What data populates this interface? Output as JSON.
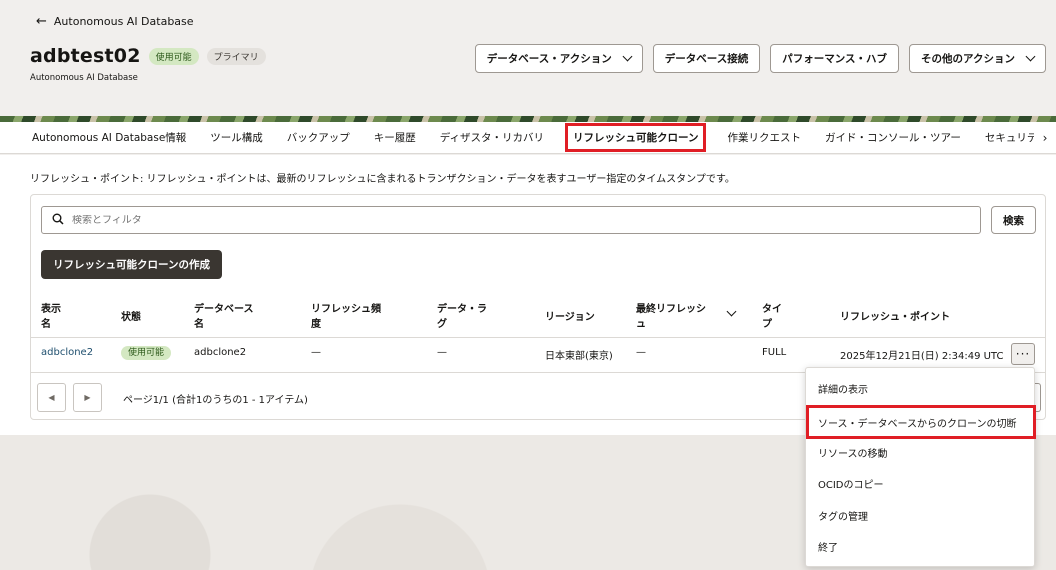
{
  "header": {
    "back_label": "Autonomous AI Database",
    "title": "adbtest02",
    "subtitle": "Autonomous AI Database",
    "badges": [
      "使用可能",
      "プライマリ"
    ],
    "actions": [
      "データベース・アクション",
      "データベース接続",
      "パフォーマンス・ハブ",
      "その他のアクション"
    ]
  },
  "tabs": [
    "Autonomous AI Database情報",
    "ツール構成",
    "バックアップ",
    "キー履歴",
    "ディザスタ・リカバリ",
    "リフレッシュ可能クローン",
    "作業リクエスト",
    "ガイド・コンソール・ツアー",
    "セキュリテ"
  ],
  "active_tab": "リフレッシュ可能クローン",
  "description": "リフレッシュ・ポイント: リフレッシュ・ポイントは、最新のリフレッシュに含まれるトランザクション・データを表すユーザー指定のタイムスタンプです。",
  "search": {
    "placeholder": "検索とフィルタ",
    "button": "検索"
  },
  "create_button": "リフレッシュ可能クローンの作成",
  "table": {
    "headers": [
      "表示\n名",
      "状態",
      "データベース\n名",
      "リフレッシュ頻\n度",
      "データ・ラ\nグ",
      "リージョン",
      "最終リフレッシ\nュ",
      "タイ\nプ",
      "リフレッシュ・ポイント"
    ],
    "rows": [
      {
        "display_name": "adbclone2",
        "state": "使用可能",
        "db_name": "adbclone2",
        "refresh_freq": "—",
        "data_lag": "—",
        "region": "日本東部(東京)",
        "last_refresh": "—",
        "type": "FULL",
        "refresh_point": "2025年12月21日(日) 2:34:49 UTC"
      }
    ]
  },
  "pagination": {
    "text": "ページ1/1 (合計1のうちの1 - 1アイテム)"
  },
  "context_menu": [
    "詳細の表示",
    "ソース・データベースからのクローンの切断",
    "リソースの移動",
    "OCIDのコピー",
    "タグの管理",
    "終了"
  ],
  "colors": {
    "highlight": "#e01e25",
    "link": "#1f4f6e",
    "badge_green": "#d4e8c2",
    "primary_button": "#3a3631"
  }
}
